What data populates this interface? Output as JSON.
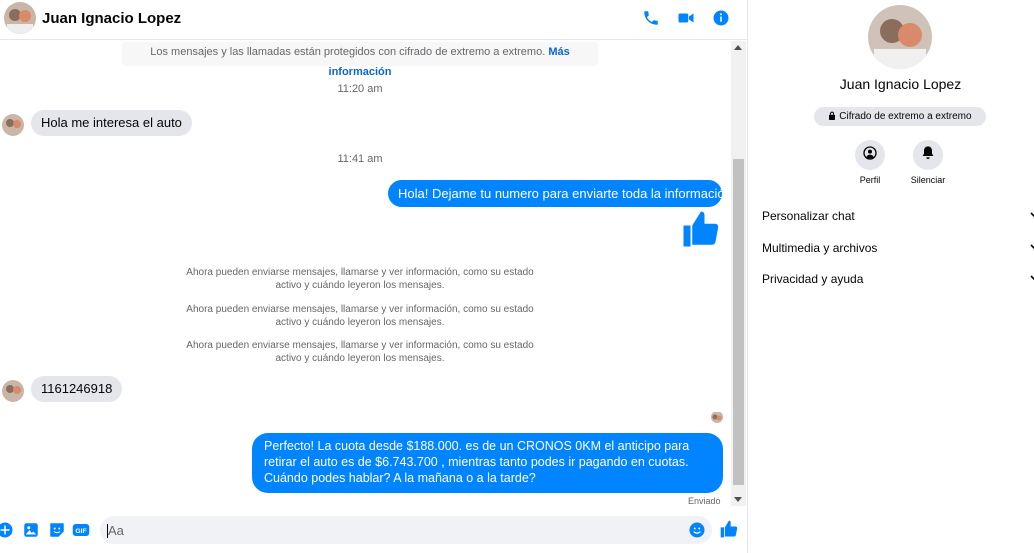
{
  "contact": {
    "name": "Juan Ignacio Lopez"
  },
  "colors": {
    "accent": "#0084ff",
    "bubble_in": "#e4e6eb",
    "link": "#0a65d8"
  },
  "header_icons": [
    "phone-icon",
    "video-icon",
    "info-icon"
  ],
  "encryption_notice": {
    "text": "Los mensajes y las llamadas están protegidos con cifrado de extremo a extremo.",
    "link": "Más información"
  },
  "messages": {
    "time1": "11:20 am",
    "in1": "Hola me interesa el auto",
    "time2": "11:41 am",
    "out1": "Hola! Dejame tu numero  para enviarte toda la información.",
    "sys1": "Ahora pueden enviarse mensajes, llamarse y ver información, como su estado activo y cuándo leyeron los mensajes.",
    "sys2": "Ahora pueden enviarse mensajes, llamarse y ver información, como su estado activo y cuándo leyeron los mensajes.",
    "sys3": "Ahora pueden enviarse mensajes, llamarse y ver información, como su estado activo y cuándo leyeron los mensajes.",
    "in2": "1161246918",
    "out2": "Perfecto! La cuota desde $188.000. es de un CRONOS 0KM el anticipo para retirar el auto es de $6.743.700 , mientras tanto podes ir pagando en cuotas. Cuándo podes hablar? A la mañana o a la tarde?",
    "status": "Enviado"
  },
  "composer": {
    "placeholder": "Aa",
    "gif_label": "GIF",
    "icons": [
      "plus-icon",
      "image-icon",
      "sticker-icon",
      "gif-icon",
      "emoji-icon",
      "thumbs-up-icon"
    ]
  },
  "panel": {
    "name": "Juan Ignacio Lopez",
    "badge": "Cifrado de extremo a extremo",
    "actions": [
      {
        "label": "Perfil"
      },
      {
        "label": "Silenciar"
      }
    ],
    "menu": [
      {
        "label": "Personalizar chat"
      },
      {
        "label": "Multimedia y archivos"
      },
      {
        "label": "Privacidad y ayuda"
      }
    ]
  }
}
